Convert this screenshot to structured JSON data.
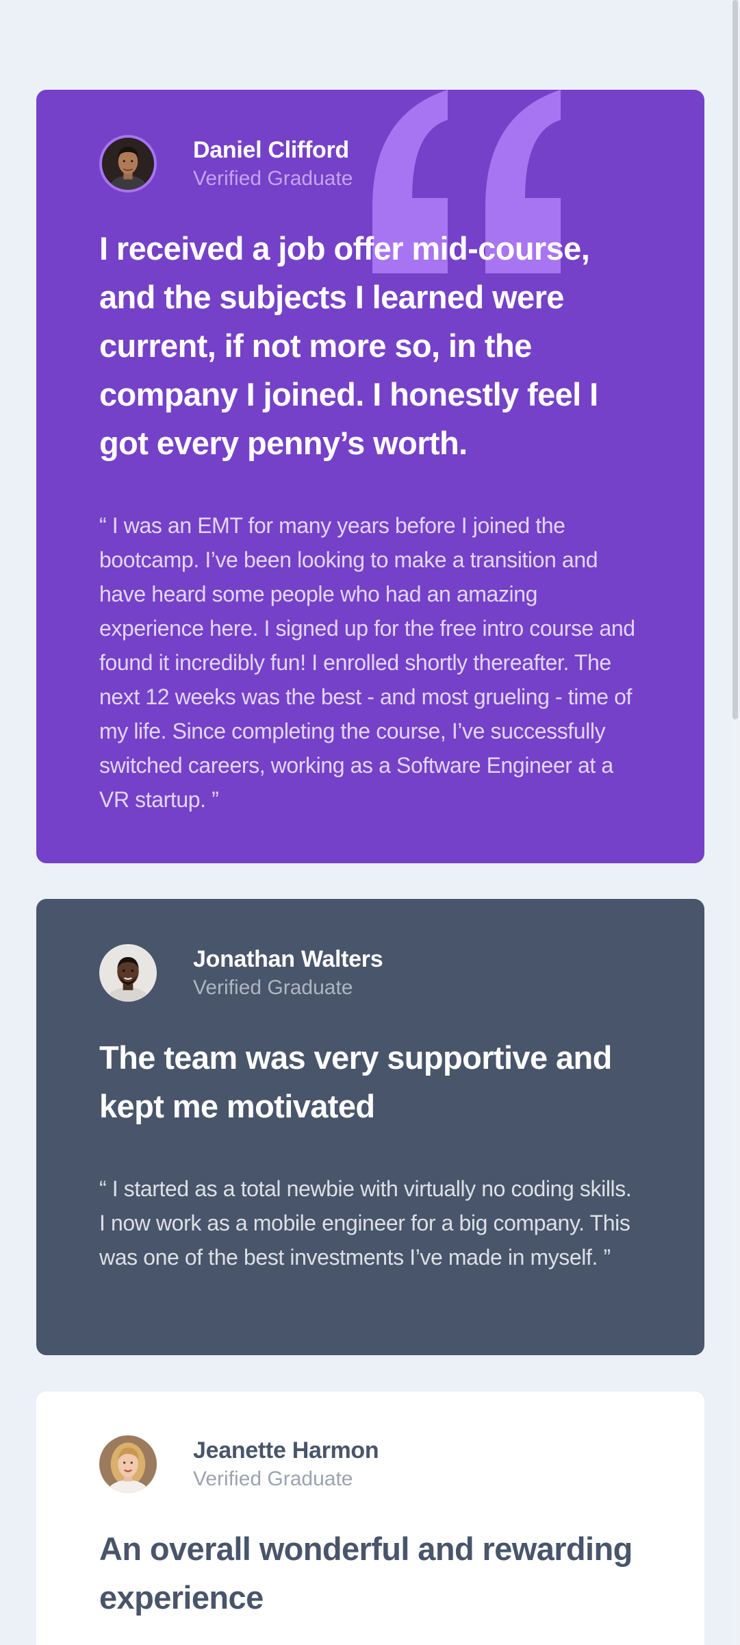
{
  "testimonials": [
    {
      "name": "Daniel Clifford",
      "role": "Verified Graduate",
      "headline": "I received a job offer mid-course, and the subjects I learned were current, if not more so, in the company I joined. I honestly feel I got every penny’s worth.",
      "body": "“ I was an EMT for many years before I joined the bootcamp. I’ve been looking to make a transition and have heard some people who had an amazing experience here. I signed up for the free intro course and found it incredibly fun! I enrolled shortly thereafter. The next 12 weeks was the best - and most grueling - time of my life. Since completing the course, I’ve successfully switched careers, working as a Software Engineer at a VR startup. ”"
    },
    {
      "name": "Jonathan Walters",
      "role": "Verified Graduate",
      "headline": "The team was very supportive and kept me motivated",
      "body": "“ I started as a total newbie with virtually no coding skills. I now work as a mobile engineer for a big company. This was one of the best investments I’ve made in myself. ”"
    },
    {
      "name": "Jeanette Harmon",
      "role": "Verified Graduate",
      "headline": "An overall wonderful and rewarding experience"
    }
  ],
  "colors": {
    "page_background": "#ECF1F8",
    "card_purple": "#7541C8",
    "card_dark": "#48556A",
    "card_white": "#FFFFFF",
    "quote_mark": "#A775F1"
  },
  "icons": {
    "quote": "quotation-mark-icon"
  }
}
